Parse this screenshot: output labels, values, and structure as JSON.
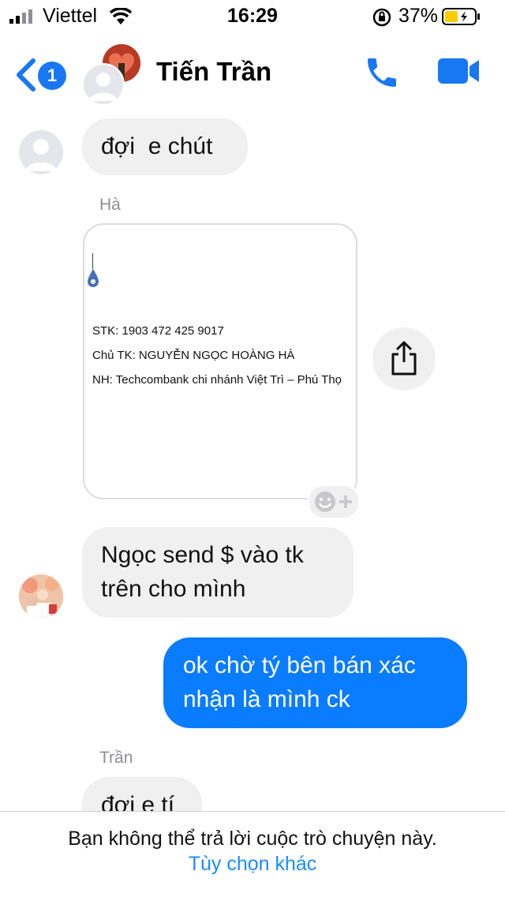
{
  "status_bar": {
    "carrier": "Viettel",
    "time": "16:29",
    "battery_percent": "37%"
  },
  "header": {
    "badge_count": "1",
    "contact_name": "Tiến Trần"
  },
  "messages": {
    "m1": "đợi  e chút",
    "sender_ha": "Hà",
    "attachment": {
      "line1": "STK: 1903 472 425 9017",
      "line2": "Chủ TK: NGUYỄN NGỌC HOÀNG HÀ",
      "line3": "NH: Techcombank chi nhánh Việt Trì – Phú Thọ"
    },
    "m2_line1": "Ngọc send $ vào tk",
    "m2_line2": "trên cho mình",
    "m3_line1": "ok chờ tý bên bán xác",
    "m3_line2": "nhận là mình ck",
    "sender_tran": "Trần",
    "m4": "đợi e tí"
  },
  "footer": {
    "notice": "Bạn không thể trả lời cuộc trò chuyện này.",
    "link": "Tùy chọn khác"
  },
  "colors": {
    "accent": "#0a7cff",
    "incoming_bubble": "#f1f0f0",
    "battery": "#ffcc00"
  }
}
